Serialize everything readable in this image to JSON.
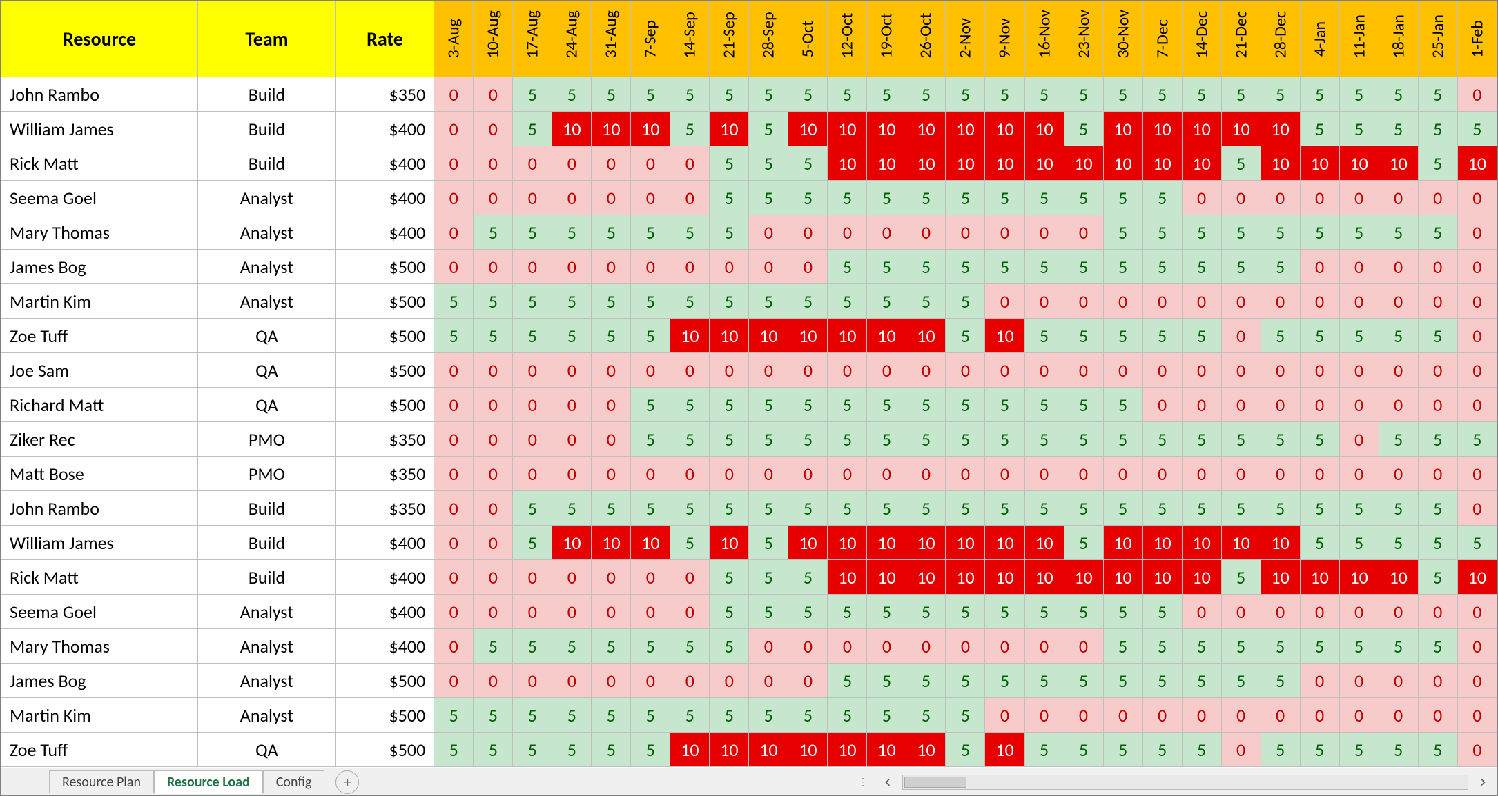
{
  "headers": {
    "resource": "Resource",
    "team": "Team",
    "rate": "Rate",
    "dates": [
      "3-Aug",
      "10-Aug",
      "17-Aug",
      "24-Aug",
      "31-Aug",
      "7-Sep",
      "14-Sep",
      "21-Sep",
      "28-Sep",
      "5-Oct",
      "12-Oct",
      "19-Oct",
      "26-Oct",
      "2-Nov",
      "9-Nov",
      "16-Nov",
      "23-Nov",
      "30-Nov",
      "7-Dec",
      "14-Dec",
      "21-Dec",
      "28-Dec",
      "4-Jan",
      "11-Jan",
      "18-Jan",
      "25-Jan",
      "1-Feb"
    ]
  },
  "rows": [
    {
      "name": "John Rambo",
      "team": "Build",
      "rate": "$350",
      "v": [
        0,
        0,
        5,
        5,
        5,
        5,
        5,
        5,
        5,
        5,
        5,
        5,
        5,
        5,
        5,
        5,
        5,
        5,
        5,
        5,
        5,
        5,
        5,
        5,
        5,
        5,
        0
      ]
    },
    {
      "name": "William James",
      "team": "Build",
      "rate": "$400",
      "v": [
        0,
        0,
        5,
        10,
        10,
        10,
        5,
        10,
        5,
        10,
        10,
        10,
        10,
        10,
        10,
        10,
        5,
        10,
        10,
        10,
        10,
        10,
        5,
        5,
        5,
        5,
        5
      ]
    },
    {
      "name": "Rick Matt",
      "team": "Build",
      "rate": "$400",
      "v": [
        0,
        0,
        0,
        0,
        0,
        0,
        0,
        5,
        5,
        5,
        10,
        10,
        10,
        10,
        10,
        10,
        10,
        10,
        10,
        10,
        5,
        10,
        10,
        10,
        10,
        5,
        10
      ]
    },
    {
      "name": "Seema Goel",
      "team": "Analyst",
      "rate": "$400",
      "v": [
        0,
        0,
        0,
        0,
        0,
        0,
        0,
        5,
        5,
        5,
        5,
        5,
        5,
        5,
        5,
        5,
        5,
        5,
        5,
        0,
        0,
        0,
        0,
        0,
        0,
        0,
        0
      ]
    },
    {
      "name": "Mary Thomas",
      "team": "Analyst",
      "rate": "$400",
      "v": [
        0,
        5,
        5,
        5,
        5,
        5,
        5,
        5,
        0,
        0,
        0,
        0,
        0,
        0,
        0,
        0,
        0,
        5,
        5,
        5,
        5,
        5,
        5,
        5,
        5,
        5,
        0
      ]
    },
    {
      "name": "James Bog",
      "team": "Analyst",
      "rate": "$500",
      "v": [
        0,
        0,
        0,
        0,
        0,
        0,
        0,
        0,
        0,
        0,
        5,
        5,
        5,
        5,
        5,
        5,
        5,
        5,
        5,
        5,
        5,
        5,
        0,
        0,
        0,
        0,
        0
      ]
    },
    {
      "name": "Martin Kim",
      "team": "Analyst",
      "rate": "$500",
      "v": [
        5,
        5,
        5,
        5,
        5,
        5,
        5,
        5,
        5,
        5,
        5,
        5,
        5,
        5,
        0,
        0,
        0,
        0,
        0,
        0,
        0,
        0,
        0,
        0,
        0,
        0,
        0
      ]
    },
    {
      "name": "Zoe Tuff",
      "team": "QA",
      "rate": "$500",
      "v": [
        5,
        5,
        5,
        5,
        5,
        5,
        10,
        10,
        10,
        10,
        10,
        10,
        10,
        5,
        10,
        5,
        5,
        5,
        5,
        5,
        0,
        5,
        5,
        5,
        5,
        5,
        0
      ]
    },
    {
      "name": "Joe Sam",
      "team": "QA",
      "rate": "$500",
      "v": [
        0,
        0,
        0,
        0,
        0,
        0,
        0,
        0,
        0,
        0,
        0,
        0,
        0,
        0,
        0,
        0,
        0,
        0,
        0,
        0,
        0,
        0,
        0,
        0,
        0,
        0,
        0
      ]
    },
    {
      "name": "Richard Matt",
      "team": "QA",
      "rate": "$500",
      "v": [
        0,
        0,
        0,
        0,
        0,
        5,
        5,
        5,
        5,
        5,
        5,
        5,
        5,
        5,
        5,
        5,
        5,
        5,
        0,
        0,
        0,
        0,
        0,
        0,
        0,
        0,
        0
      ]
    },
    {
      "name": "Ziker Rec",
      "team": "PMO",
      "rate": "$350",
      "v": [
        0,
        0,
        0,
        0,
        0,
        5,
        5,
        5,
        5,
        5,
        5,
        5,
        5,
        5,
        5,
        5,
        5,
        5,
        5,
        5,
        5,
        5,
        5,
        0,
        5,
        5,
        5
      ]
    },
    {
      "name": "Matt Bose",
      "team": "PMO",
      "rate": "$350",
      "v": [
        0,
        0,
        0,
        0,
        0,
        0,
        0,
        0,
        0,
        0,
        0,
        0,
        0,
        0,
        0,
        0,
        0,
        0,
        0,
        0,
        0,
        0,
        0,
        0,
        0,
        0,
        0
      ]
    },
    {
      "name": "John Rambo",
      "team": "Build",
      "rate": "$350",
      "v": [
        0,
        0,
        5,
        5,
        5,
        5,
        5,
        5,
        5,
        5,
        5,
        5,
        5,
        5,
        5,
        5,
        5,
        5,
        5,
        5,
        5,
        5,
        5,
        5,
        5,
        5,
        0
      ]
    },
    {
      "name": "William James",
      "team": "Build",
      "rate": "$400",
      "v": [
        0,
        0,
        5,
        10,
        10,
        10,
        5,
        10,
        5,
        10,
        10,
        10,
        10,
        10,
        10,
        10,
        5,
        10,
        10,
        10,
        10,
        10,
        5,
        5,
        5,
        5,
        5
      ]
    },
    {
      "name": "Rick Matt",
      "team": "Build",
      "rate": "$400",
      "v": [
        0,
        0,
        0,
        0,
        0,
        0,
        0,
        5,
        5,
        5,
        10,
        10,
        10,
        10,
        10,
        10,
        10,
        10,
        10,
        10,
        5,
        10,
        10,
        10,
        10,
        5,
        10
      ]
    },
    {
      "name": "Seema Goel",
      "team": "Analyst",
      "rate": "$400",
      "v": [
        0,
        0,
        0,
        0,
        0,
        0,
        0,
        5,
        5,
        5,
        5,
        5,
        5,
        5,
        5,
        5,
        5,
        5,
        5,
        0,
        0,
        0,
        0,
        0,
        0,
        0,
        0
      ]
    },
    {
      "name": "Mary Thomas",
      "team": "Analyst",
      "rate": "$400",
      "v": [
        0,
        5,
        5,
        5,
        5,
        5,
        5,
        5,
        0,
        0,
        0,
        0,
        0,
        0,
        0,
        0,
        0,
        5,
        5,
        5,
        5,
        5,
        5,
        5,
        5,
        5,
        0
      ]
    },
    {
      "name": "James Bog",
      "team": "Analyst",
      "rate": "$500",
      "v": [
        0,
        0,
        0,
        0,
        0,
        0,
        0,
        0,
        0,
        0,
        5,
        5,
        5,
        5,
        5,
        5,
        5,
        5,
        5,
        5,
        5,
        5,
        0,
        0,
        0,
        0,
        0
      ]
    },
    {
      "name": "Martin Kim",
      "team": "Analyst",
      "rate": "$500",
      "v": [
        5,
        5,
        5,
        5,
        5,
        5,
        5,
        5,
        5,
        5,
        5,
        5,
        5,
        5,
        0,
        0,
        0,
        0,
        0,
        0,
        0,
        0,
        0,
        0,
        0,
        0,
        0
      ]
    },
    {
      "name": "Zoe Tuff",
      "team": "QA",
      "rate": "$500",
      "v": [
        5,
        5,
        5,
        5,
        5,
        5,
        10,
        10,
        10,
        10,
        10,
        10,
        10,
        5,
        10,
        5,
        5,
        5,
        5,
        5,
        0,
        5,
        5,
        5,
        5,
        5,
        0
      ]
    }
  ],
  "tabs": {
    "items": [
      "Resource Plan",
      "Resource Load",
      "Config"
    ],
    "active_index": 1
  }
}
